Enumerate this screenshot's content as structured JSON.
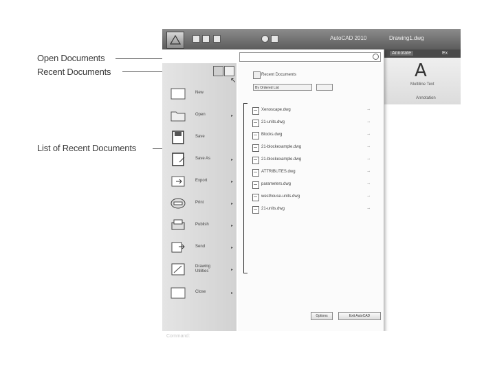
{
  "callouts": {
    "open_documents": "Open Documents",
    "recent_documents": "Recent Documents",
    "list_of_recent_documents": "List of Recent Documents"
  },
  "titlebar": {
    "app_name": "AutoCAD 2010",
    "drawing_name": "Drawing1.dwg"
  },
  "ribbon": {
    "tab_active": "Annotate",
    "tab_other": "Ex",
    "big_letter": "A",
    "multiline_label": "Multiline Text",
    "panel_label": "Annotation"
  },
  "menu": {
    "search_placeholder": "",
    "items": [
      {
        "label": "New",
        "has_arrow": false
      },
      {
        "label": "Open",
        "has_arrow": true
      },
      {
        "label": "Save",
        "has_arrow": false
      },
      {
        "label": "Save As",
        "has_arrow": true
      },
      {
        "label": "Export",
        "has_arrow": true
      },
      {
        "label": "Print",
        "has_arrow": true
      },
      {
        "label": "Publish",
        "has_arrow": true
      },
      {
        "label": "Send",
        "has_arrow": true
      },
      {
        "label": "Drawing Utilities",
        "has_arrow": true
      },
      {
        "label": "Close",
        "has_arrow": true
      }
    ],
    "arrow_glyph": "▸"
  },
  "recent": {
    "title": "Recent Documents",
    "order_by": "By Ordered List",
    "view_by": "",
    "documents": [
      "Xenoscape.dwg",
      "21-units.dwg",
      "Blocks.dwg",
      "21-blockexample.dwg",
      "21-blockexample.dwg",
      "ATTRIBUTES.dwg",
      "parameters.dwg",
      "westhouse-units.dwg",
      "21-units.dwg"
    ],
    "pin_glyph": "⊸"
  },
  "buttons": {
    "options": "Options",
    "exit": "Exit AutoCAD"
  },
  "footer_text": "Command:"
}
